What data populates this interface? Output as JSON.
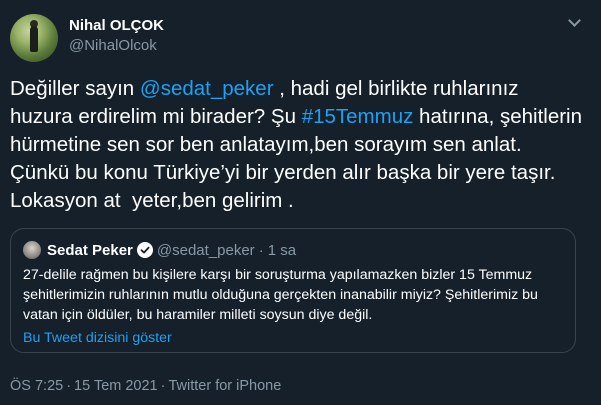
{
  "author": {
    "name": "Nihal OLÇOK",
    "handle": "@NihalOlcok"
  },
  "tweet": {
    "part1": "Değiller sayın ",
    "mention": "@sedat_peker",
    "part2": " , hadi gel birlikte ruhlarınız huzura erdirelim mi birader? Şu ",
    "hashtag": "#15Temmuz",
    "part3": " hatırına, şehitlerin hürmetine sen sor ben anlatayım,ben sorayım sen anlat. Çünkü bu konu Türkiye’yi bir yerden alır başka bir yere taşır. Lokasyon at  yeter,ben gelirim ."
  },
  "quoted": {
    "name": "Sedat Peker",
    "handle": "@sedat_peker",
    "dot": "·",
    "time": "1 sa",
    "text": "27-delile rağmen bu kişilere karşı bir soruşturma yapılamazken bizler 15 Temmuz şehitlerimizin ruhlarının mutlu olduğuna gerçekten inanabilir miyiz? Şehitlerimiz bu vatan için öldüler, bu haramiler milleti soysun diye değil.",
    "thread_link": "Bu Tweet dizisini göster",
    "verified_icon": "verified-badge-icon"
  },
  "meta": {
    "time": "ÖS 7:25",
    "sep": "·",
    "date": "15 Tem 2021",
    "source": "Twitter for iPhone"
  },
  "colors": {
    "background": "#15202b",
    "link": "#1da1f2",
    "secondary_text": "#8899a6",
    "border": "#38444d"
  }
}
